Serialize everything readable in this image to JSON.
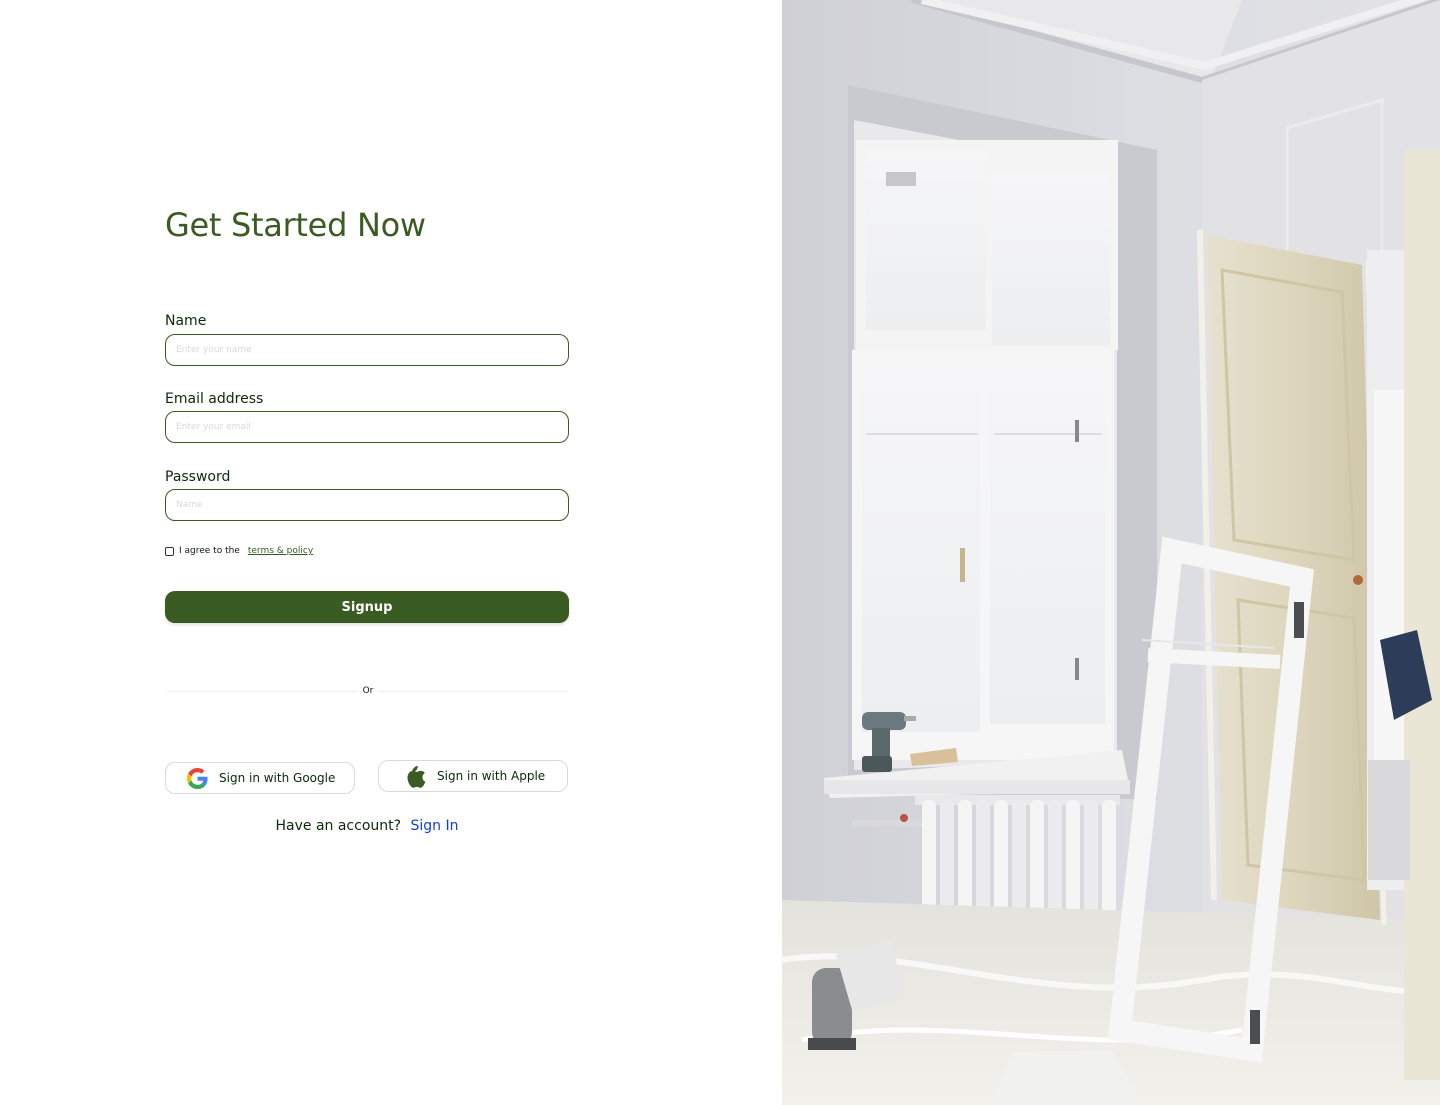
{
  "form": {
    "title": "Get Started Now",
    "name": {
      "label": "Name",
      "placeholder": "Enter your name",
      "value": ""
    },
    "email": {
      "label": "Email address",
      "placeholder": "Enter your email",
      "value": ""
    },
    "password": {
      "label": "Password",
      "placeholder": "Name",
      "value": ""
    },
    "agree": {
      "text": "I agree to the",
      "link": "terms & policy",
      "checked": false
    },
    "signup_label": "Signup",
    "divider_label": "Or",
    "google": {
      "label": "Sign in with Google",
      "icon": "google-icon"
    },
    "apple": {
      "label": "Sign in with Apple",
      "icon": "apple-icon"
    },
    "account": {
      "text": "Have an account?",
      "link": "Sign In"
    }
  },
  "hero_image": {
    "subject": "bright room under renovation with tall white windows, radiator, doors wrapped in plastic, a window frame leaning on the wall and a drill on the sill"
  },
  "colors": {
    "primary": "#3a5b22",
    "link": "#0f3dde",
    "input_border": "#3a5b22",
    "social_border": "#d9d9d9"
  }
}
